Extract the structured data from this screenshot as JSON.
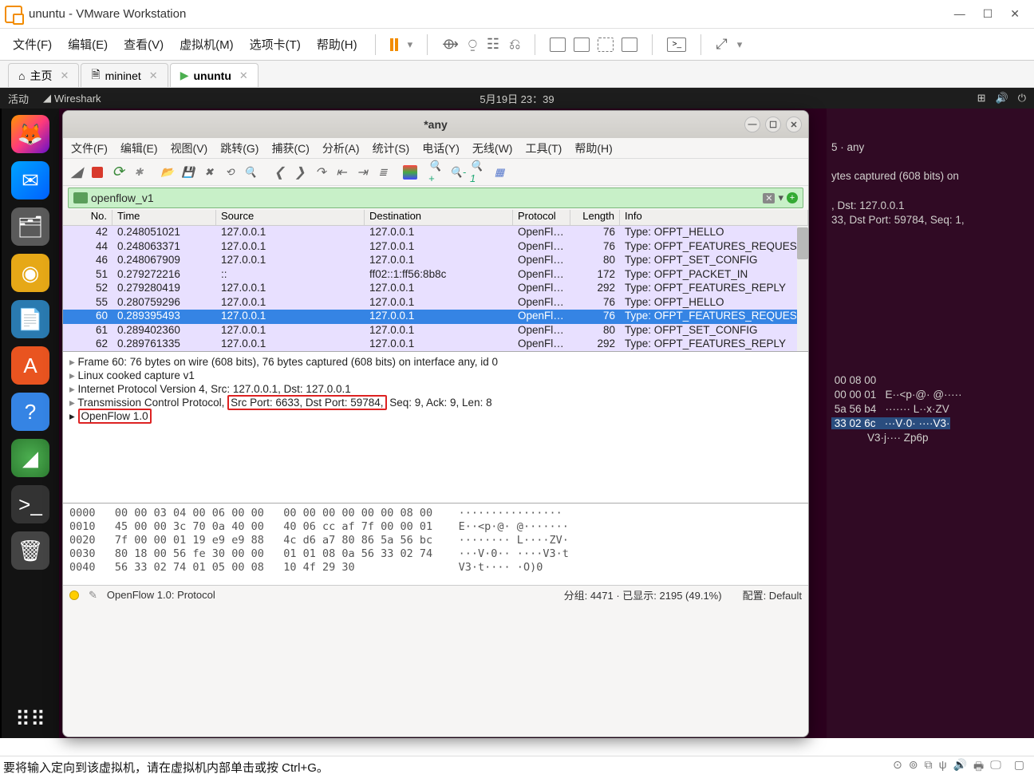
{
  "vmware": {
    "title": "ununtu - VMware Workstation",
    "menu": [
      "文件(F)",
      "编辑(E)",
      "查看(V)",
      "虚拟机(M)",
      "选项卡(T)",
      "帮助(H)"
    ],
    "tabs": [
      {
        "label": "主页",
        "icon": "home"
      },
      {
        "label": "mininet",
        "icon": "doc"
      },
      {
        "label": "ununtu",
        "icon": "doc",
        "active": true
      }
    ]
  },
  "gnome": {
    "activities": "活动",
    "app": "Wireshark",
    "clock": "5月19日 23：39"
  },
  "wireshark": {
    "title": "*any",
    "menu": [
      "文件(F)",
      "编辑(E)",
      "视图(V)",
      "跳转(G)",
      "捕获(C)",
      "分析(A)",
      "统计(S)",
      "电话(Y)",
      "无线(W)",
      "工具(T)",
      "帮助(H)"
    ],
    "filter": "openflow_v1",
    "columns": [
      "No.",
      "Time",
      "Source",
      "Destination",
      "Protocol",
      "Length",
      "Info"
    ],
    "rows": [
      {
        "no": "42",
        "time": "0.248051021",
        "src": "127.0.0.1",
        "dst": "127.0.0.1",
        "proto": "OpenFl…",
        "len": "76",
        "info": "Type: OFPT_HELLO",
        "sel": false
      },
      {
        "no": "44",
        "time": "0.248063371",
        "src": "127.0.0.1",
        "dst": "127.0.0.1",
        "proto": "OpenFl…",
        "len": "76",
        "info": "Type: OFPT_FEATURES_REQUES",
        "sel": false
      },
      {
        "no": "46",
        "time": "0.248067909",
        "src": "127.0.0.1",
        "dst": "127.0.0.1",
        "proto": "OpenFl…",
        "len": "80",
        "info": "Type: OFPT_SET_CONFIG",
        "sel": false
      },
      {
        "no": "51",
        "time": "0.279272216",
        "src": "::",
        "dst": "ff02::1:ff56:8b8c",
        "proto": "OpenFl…",
        "len": "172",
        "info": "Type: OFPT_PACKET_IN",
        "sel": false
      },
      {
        "no": "52",
        "time": "0.279280419",
        "src": "127.0.0.1",
        "dst": "127.0.0.1",
        "proto": "OpenFl…",
        "len": "292",
        "info": "Type: OFPT_FEATURES_REPLY",
        "sel": false
      },
      {
        "no": "55",
        "time": "0.280759296",
        "src": "127.0.0.1",
        "dst": "127.0.0.1",
        "proto": "OpenFl…",
        "len": "76",
        "info": "Type: OFPT_HELLO",
        "sel": false
      },
      {
        "no": "60",
        "time": "0.289395493",
        "src": "127.0.0.1",
        "dst": "127.0.0.1",
        "proto": "OpenFl…",
        "len": "76",
        "info": "Type: OFPT_FEATURES_REQUES",
        "sel": true
      },
      {
        "no": "61",
        "time": "0.289402360",
        "src": "127.0.0.1",
        "dst": "127.0.0.1",
        "proto": "OpenFl…",
        "len": "80",
        "info": "Type: OFPT_SET_CONFIG",
        "sel": false
      },
      {
        "no": "62",
        "time": "0.289761335",
        "src": "127.0.0.1",
        "dst": "127.0.0.1",
        "proto": "OpenFl…",
        "len": "292",
        "info": "Type: OFPT_FEATURES_REPLY",
        "sel": false
      }
    ],
    "details": {
      "frame": "Frame 60: 76 bytes on wire (608 bits), 76 bytes captured (608 bits) on interface any, id 0",
      "linux": "Linux cooked capture v1",
      "ip": "Internet Protocol Version 4, Src: 127.0.0.1, Dst: 127.0.0.1",
      "tcp_pre": "Transmission Control Protocol,",
      "tcp_box": "Src Port: 6633, Dst Port: 59784,",
      "tcp_post": " Seq: 9, Ack: 9, Len: 8",
      "of": "OpenFlow 1.0"
    },
    "bytes": [
      "0000   00 00 03 04 00 06 00 00   00 00 00 00 00 00 08 00    ················",
      "0010   45 00 00 3c 70 0a 40 00   40 06 cc af 7f 00 00 01    E··<p·@· @·······",
      "0020   7f 00 00 01 19 e9 e9 88   4c d6 a7 80 86 5a 56 bc    ········ L····ZV·",
      "0030   80 18 00 56 fe 30 00 00   01 01 08 0a 56 33 02 74    ···V·0·· ····V3·t",
      "0040   56 33 02 74 01 05 00 08   10 4f 29 30                V3·t···· ·O)0"
    ],
    "status": {
      "proto": "OpenFlow 1.0: Protocol",
      "pkts": "分组: 4471 · 已显示: 2195 (49.1%)",
      "profile": "配置: Default"
    }
  },
  "bg_term": {
    "title": "5 · any",
    "l1": "ytes captured (608 bits) on",
    "l2": ", Dst: 127.0.0.1",
    "l3": "33, Dst Port: 59784, Seq: 1,",
    "h1": " 00 08 00",
    "h2": " 00 00 01   E··<p·@· @·····",
    "h3": " 5a 56 b4   ······· L··x·ZV",
    "h4": " 33 02 6c   ···V·0· ····V3·",
    "h5": "            V3·j···· Zp6p"
  },
  "bottom": {
    "hint": "要将输入定向到该虚拟机，请在虚拟机内部单击或按 Ctrl+G。"
  }
}
